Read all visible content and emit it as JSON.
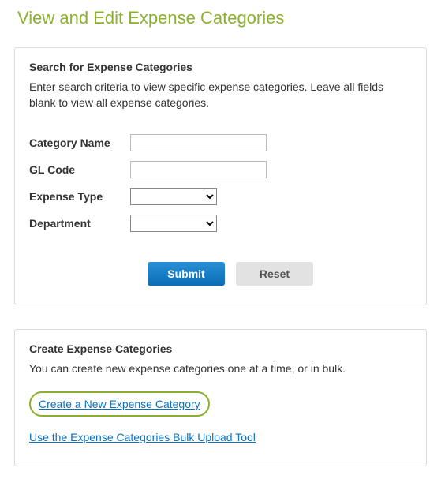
{
  "page": {
    "title": "View and Edit Expense Categories"
  },
  "search_panel": {
    "title": "Search for Expense Categories",
    "description": "Enter search criteria to view specific expense categories. Leave all fields blank to view all expense categories.",
    "fields": {
      "category_name": {
        "label": "Category Name",
        "value": ""
      },
      "gl_code": {
        "label": "GL Code",
        "value": ""
      },
      "expense_type": {
        "label": "Expense Type",
        "selected": ""
      },
      "department": {
        "label": "Department",
        "selected": ""
      }
    },
    "buttons": {
      "submit": "Submit",
      "reset": "Reset"
    }
  },
  "create_panel": {
    "title": "Create Expense Categories",
    "description": "You can create new expense categories one at a time, or in bulk.",
    "links": {
      "create_new": "Create a New Expense Category",
      "bulk_upload": "Use the Expense Categories Bulk Upload Tool"
    }
  }
}
